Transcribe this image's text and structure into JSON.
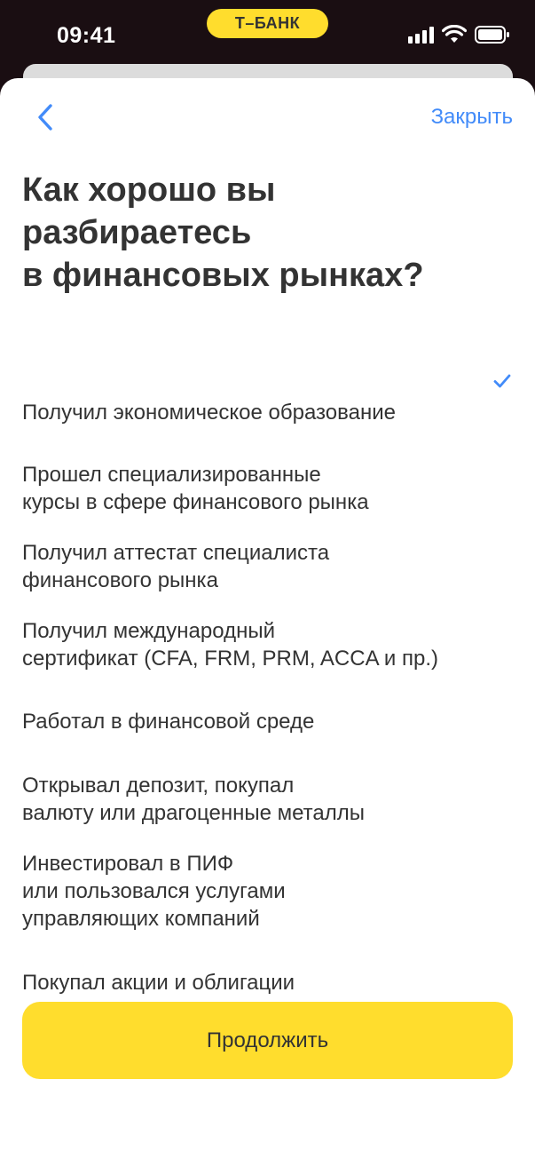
{
  "status_bar": {
    "time": "09:41",
    "brand": "Т–БАНК",
    "icons": [
      "signal-icon",
      "wifi-icon",
      "battery-icon"
    ]
  },
  "header": {
    "back_icon": "chevron-left-icon",
    "close_label": "Закрыть"
  },
  "question": {
    "title": "Как хорошо вы\nразбираетесь\nв финансовых рынках?"
  },
  "options": [
    {
      "label": "Получил экономическое образование",
      "selected": true
    },
    {
      "label": "Прошел специализированные\nкурсы в сфере финансового рынка",
      "selected": false
    },
    {
      "label": "Получил аттестат специалиста\nфинансового рынка",
      "selected": false
    },
    {
      "label": "Получил международный\nсертификат (CFA, FRM, PRM, ACCA и пр.)",
      "selected": false
    },
    {
      "label": "Работал в финансовой среде",
      "selected": false
    },
    {
      "label": "Открывал депозит, покупал\nвалюту или драгоценные металлы",
      "selected": false
    },
    {
      "label": "Инвестировал в ПИФ\nили пользовался услугами\nуправляющих компаний",
      "selected": false
    },
    {
      "label": "Покупал акции и облигации",
      "selected": false
    }
  ],
  "footer": {
    "continue_label": "Продолжить"
  },
  "colors": {
    "accent": "#428bf9",
    "brand_yellow": "#ffdd2d",
    "text": "#333333",
    "status_bg": "#1a0e12"
  }
}
